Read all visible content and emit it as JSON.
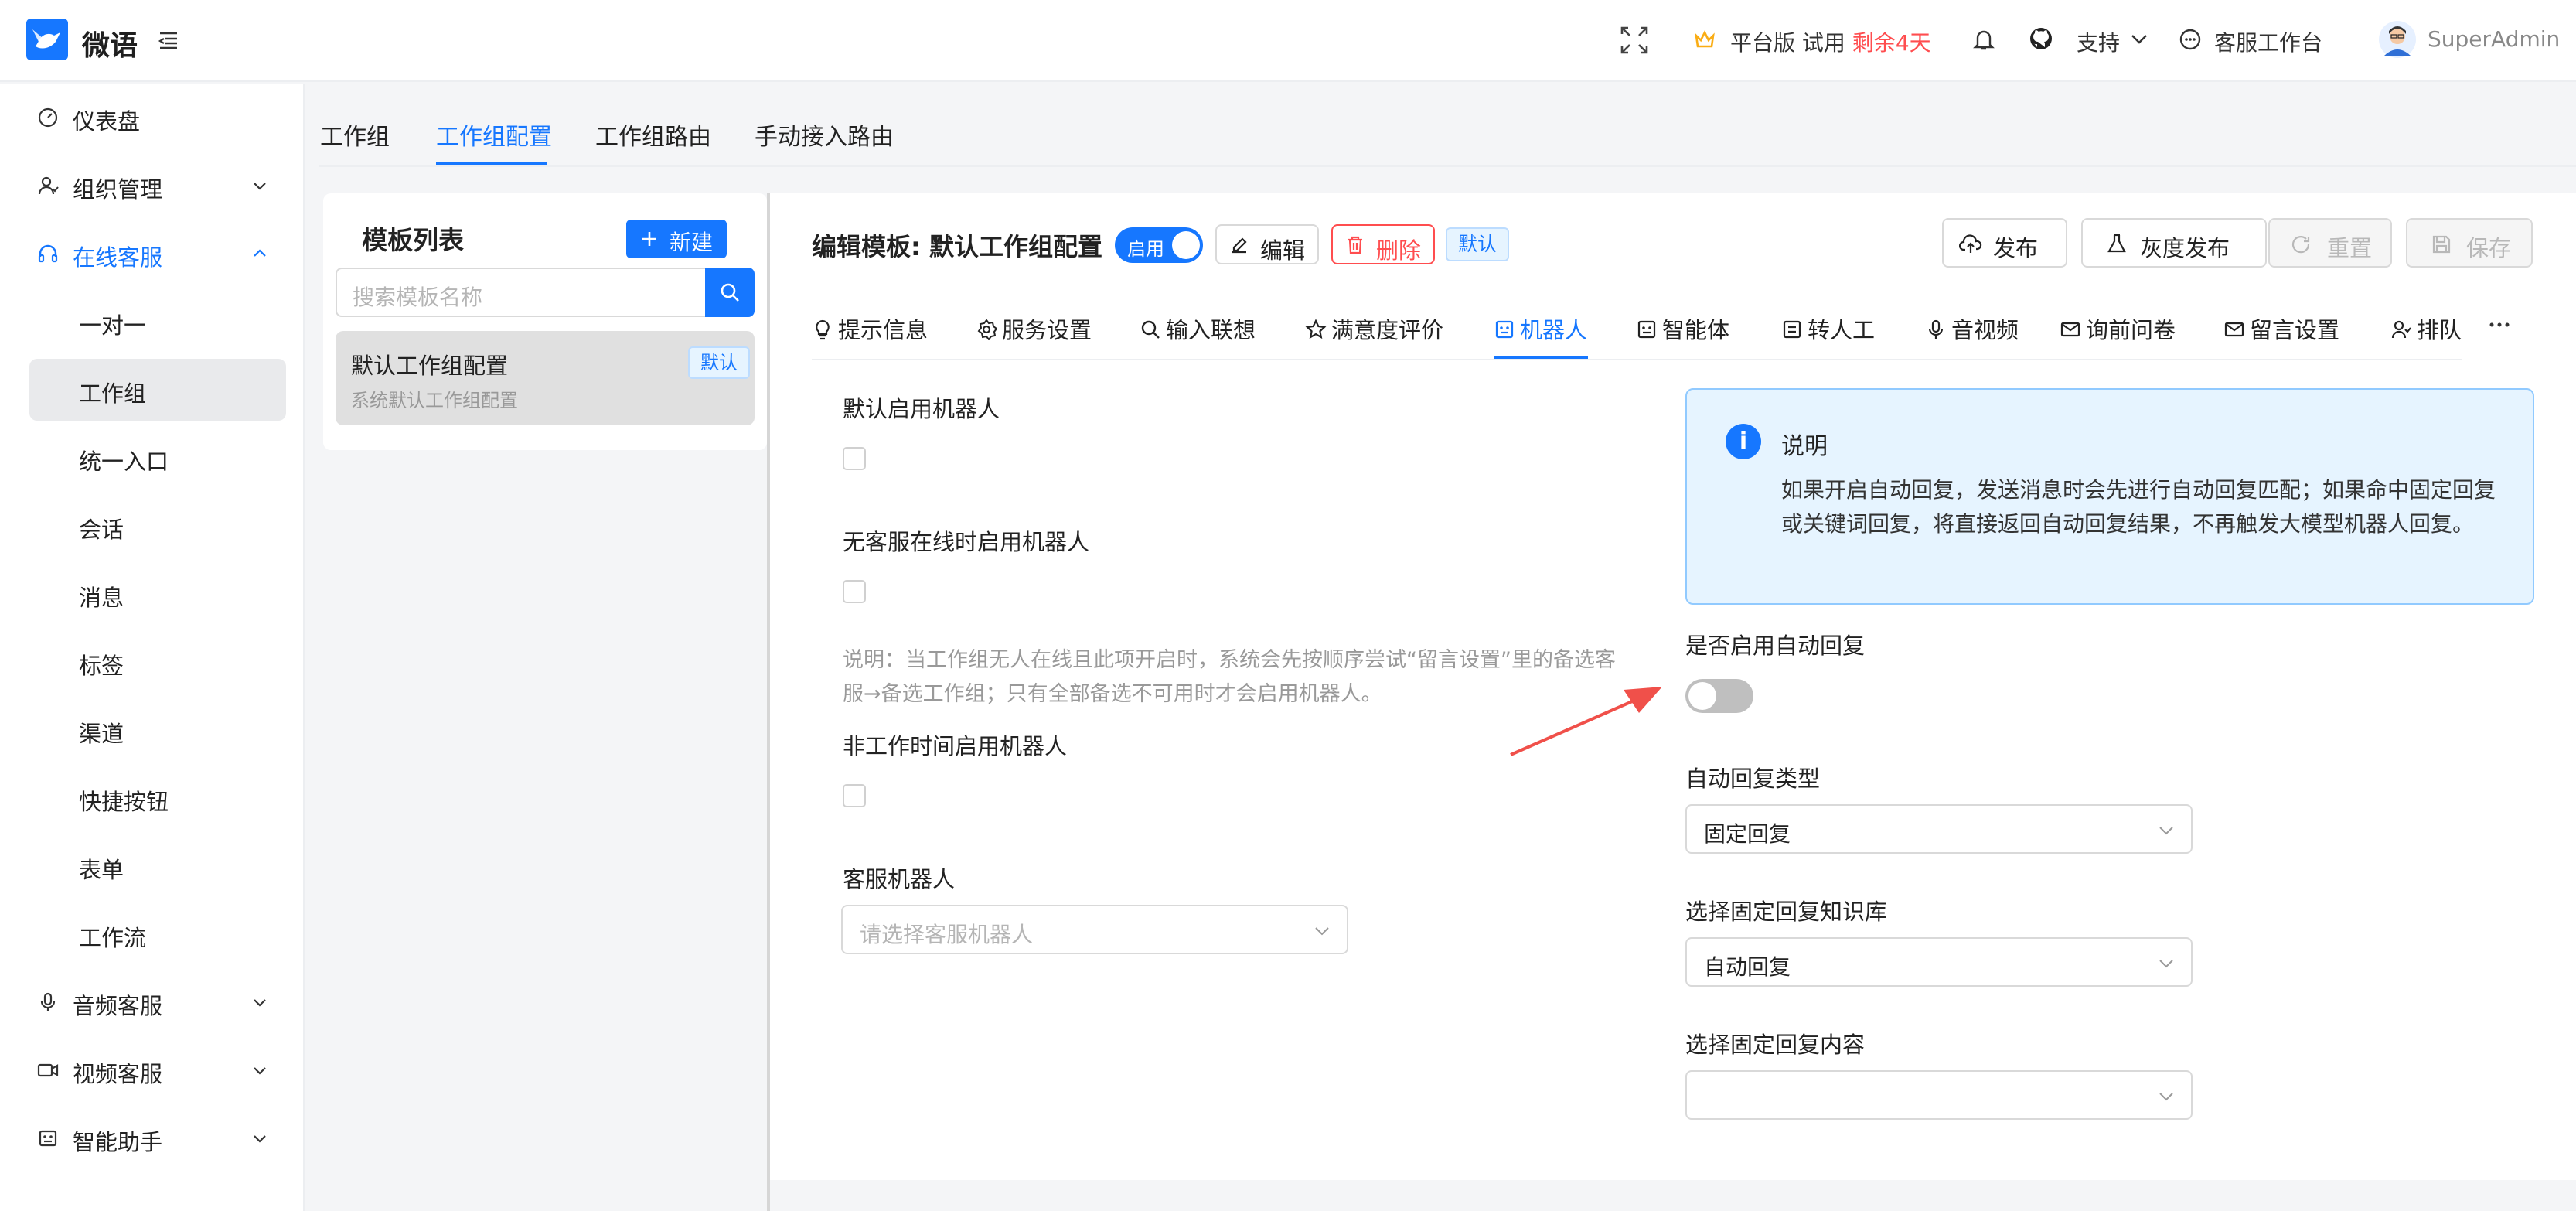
{
  "app": {
    "brand": "微语"
  },
  "header": {
    "plan_prefix": "平台版 试用",
    "plan_remaining": "剩余4天",
    "support": "支持",
    "workbench": "客服工作台",
    "user": "SuperAdmin"
  },
  "sidebar": {
    "items": [
      {
        "label": "仪表盘"
      },
      {
        "label": "组织管理"
      },
      {
        "label": "在线客服"
      },
      {
        "label": "音频客服"
      },
      {
        "label": "视频客服"
      },
      {
        "label": "智能助手"
      }
    ],
    "sub_items": [
      {
        "label": "一对一"
      },
      {
        "label": "工作组"
      },
      {
        "label": "统一入口"
      },
      {
        "label": "会话"
      },
      {
        "label": "消息"
      },
      {
        "label": "标签"
      },
      {
        "label": "渠道"
      },
      {
        "label": "快捷按钮"
      },
      {
        "label": "表单"
      },
      {
        "label": "工作流"
      }
    ]
  },
  "top_tabs": [
    {
      "label": "工作组"
    },
    {
      "label": "工作组配置"
    },
    {
      "label": "工作组路由"
    },
    {
      "label": "手动接入路由"
    }
  ],
  "template_list": {
    "title": "模板列表",
    "new_button": "新建",
    "search_placeholder": "搜索模板名称",
    "items": [
      {
        "name": "默认工作组配置",
        "desc": "系统默认工作组配置",
        "badge": "默认"
      }
    ]
  },
  "editor": {
    "title": "编辑模板: 默认工作组配置",
    "enabled_label": "启用",
    "edit_button": "编辑",
    "delete_button": "删除",
    "default_badge": "默认",
    "publish_button": "发布",
    "gray_publish_button": "灰度发布",
    "reset_button": "重置",
    "save_button": "保存"
  },
  "config_tabs": [
    {
      "label": "提示信息",
      "icon": "bulb-icon"
    },
    {
      "label": "服务设置",
      "icon": "gear-icon"
    },
    {
      "label": "输入联想",
      "icon": "search-icon"
    },
    {
      "label": "满意度评价",
      "icon": "star-icon"
    },
    {
      "label": "机器人",
      "icon": "robot-icon"
    },
    {
      "label": "智能体",
      "icon": "agent-icon"
    },
    {
      "label": "转人工",
      "icon": "transfer-icon"
    },
    {
      "label": "音视频",
      "icon": "mic-icon"
    },
    {
      "label": "询前问卷",
      "icon": "mail-icon"
    },
    {
      "label": "留言设置",
      "icon": "mail-icon"
    },
    {
      "label": "排队",
      "icon": "queue-icon"
    }
  ],
  "robot_form": {
    "default_robot_label": "默认启用机器人",
    "no_agent_robot_label": "无客服在线时启用机器人",
    "hint_line1": "说明：当工作组无人在线且此项开启时，系统会先按顺序尝试“留言设置”里的备选客",
    "hint_line2": "服→备选工作组；只有全部备选不可用时才会启用机器人。",
    "off_hours_robot_label": "非工作时间启用机器人",
    "service_robot_label": "客服机器人",
    "service_robot_placeholder": "请选择客服机器人"
  },
  "info": {
    "title": "说明",
    "body": "如果开启自动回复，发送消息时会先进行自动回复匹配；如果命中固定回复或关键词回复，将直接返回自动回复结果，不再触发大模型机器人回复。"
  },
  "auto_reply": {
    "enable_label": "是否启用自动回复",
    "enabled": false,
    "type_label": "自动回复类型",
    "type_value": "固定回复",
    "kb_label": "选择固定回复知识库",
    "kb_value": "自动回复",
    "content_label": "选择固定回复内容",
    "content_value": ""
  },
  "colors": {
    "accent": "#1677ff",
    "danger": "#ff4d4f",
    "arrow": "#f0504a"
  }
}
